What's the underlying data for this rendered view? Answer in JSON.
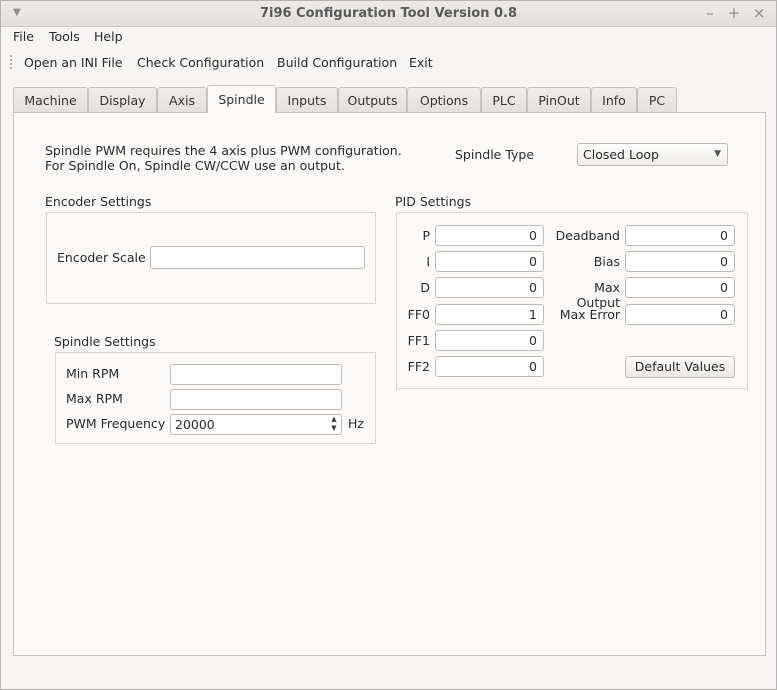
{
  "window": {
    "title": "7i96 Configuration Tool Version 0.8"
  },
  "menubar": {
    "items": [
      "File",
      "Tools",
      "Help"
    ]
  },
  "toolbar": {
    "items": [
      "Open an INI File",
      "Check Configuration",
      "Build Configuration",
      "Exit"
    ]
  },
  "tabs": {
    "items": [
      "Machine",
      "Display",
      "Axis",
      "Spindle",
      "Inputs",
      "Outputs",
      "Options",
      "PLC",
      "PinOut",
      "Info",
      "PC"
    ],
    "active": "Spindle"
  },
  "spindle": {
    "info_line1": "Spindle PWM requires the 4 axis plus PWM configuration.",
    "info_line2": "For Spindle On, Spindle CW/CCW use an output.",
    "type_label": "Spindle Type",
    "type_value": "Closed Loop"
  },
  "encoder": {
    "group_title": "Encoder Settings",
    "scale_label": "Encoder Scale",
    "scale_value": ""
  },
  "spindle_settings": {
    "group_title": "Spindle Settings",
    "min_rpm_label": "Min RPM",
    "min_rpm_value": "",
    "max_rpm_label": "Max RPM",
    "max_rpm_value": "",
    "pwm_label": "PWM Frequency",
    "pwm_value": "20000",
    "pwm_unit": "Hz"
  },
  "pid": {
    "group_title": "PID Settings",
    "left": [
      {
        "label": "P",
        "value": "0"
      },
      {
        "label": "I",
        "value": "0"
      },
      {
        "label": "D",
        "value": "0"
      },
      {
        "label": "FF0",
        "value": "1"
      },
      {
        "label": "FF1",
        "value": "0"
      },
      {
        "label": "FF2",
        "value": "0"
      }
    ],
    "right": [
      {
        "label": "Deadband",
        "value": "0"
      },
      {
        "label": "Bias",
        "value": "0"
      },
      {
        "label": "Max Output",
        "value": "0"
      },
      {
        "label": "Max Error",
        "value": "0"
      }
    ],
    "default_button": "Default Values"
  },
  "icons": {
    "window_menu": "chevron-down-icon",
    "minimize": "minimize-icon",
    "maximize": "maximize-icon",
    "close": "close-icon",
    "spin_up": "triangle-up-icon",
    "spin_down": "triangle-down-icon"
  }
}
